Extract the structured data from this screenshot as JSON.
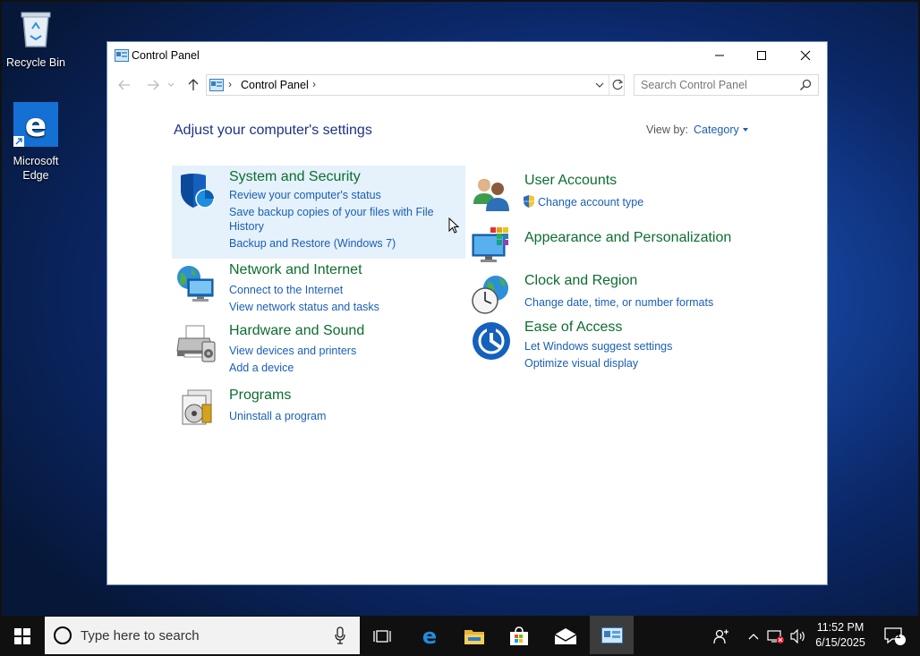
{
  "desktop": {
    "recycle_bin": "Recycle Bin",
    "edge": "Microsoft Edge"
  },
  "window": {
    "title": "Control Panel",
    "address_crumb": "Control Panel",
    "search_placeholder": "Search Control Panel",
    "heading": "Adjust your computer's settings",
    "view_by_label": "View by:",
    "view_by_value": "Category"
  },
  "categories": {
    "system": {
      "title": "System and Security",
      "links": [
        "Review your computer's status",
        "Save backup copies of your files with File",
        "History",
        "Backup and Restore (Windows 7)"
      ]
    },
    "network": {
      "title": "Network and Internet",
      "links": [
        "Connect to the Internet",
        "View network status and tasks"
      ]
    },
    "hardware": {
      "title": "Hardware and Sound",
      "links": [
        "View devices and printers",
        "Add a device"
      ]
    },
    "programs": {
      "title": "Programs",
      "links": [
        "Uninstall a program"
      ]
    },
    "users": {
      "title": "User Accounts",
      "links": [
        "Change account type"
      ]
    },
    "appearance": {
      "title": "Appearance and Personalization",
      "links": []
    },
    "clock": {
      "title": "Clock and Region",
      "links": [
        "Change date, time, or number formats"
      ]
    },
    "ease": {
      "title": "Ease of Access",
      "links": [
        "Let Windows suggest settings",
        "Optimize visual display"
      ]
    }
  },
  "taskbar": {
    "search_placeholder": "Type here to search",
    "time": "11:52 PM",
    "date": "6/15/2025",
    "notification_count": "1"
  },
  "colors": {
    "title_green": "#0c6d30",
    "link_blue": "#1a5fb4",
    "heading_blue": "#1e3287",
    "highlight": "#e5f1fb"
  }
}
